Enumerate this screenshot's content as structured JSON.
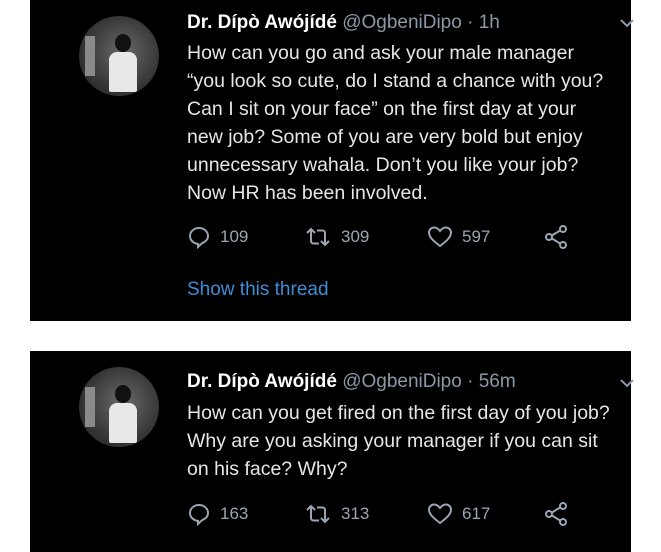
{
  "tweets": [
    {
      "author_name": "Dr. Dípò Awójídé",
      "handle": "@OgbeniDipo",
      "time": "· 1h",
      "text": "How can you go and ask your male manager\n“you look so cute, do I stand a chance with you?\nCan I sit on your face” on the first day at your\nnew job? Some of you are very bold but enjoy\nunnecessary wahala. Don’t you like your job?\nNow HR has been involved.",
      "replies": "109",
      "retweets": "309",
      "likes": "597",
      "show_thread": "Show this thread"
    },
    {
      "author_name": "Dr. Dípò Awójídé",
      "handle": "@OgbeniDipo",
      "time": "· 56m",
      "text": "How can you get fired on the first day of you job?\nWhy are you asking your manager if you can sit\non his face? Why?",
      "replies": "163",
      "retweets": "313",
      "likes": "617"
    }
  ],
  "colors": {
    "background": "#000000",
    "name": "#ffffff",
    "meta": "#8b98a5",
    "link": "#3e8ed6"
  },
  "icons": [
    "reply-icon",
    "retweet-icon",
    "like-icon",
    "share-icon",
    "chevron-down-icon"
  ]
}
